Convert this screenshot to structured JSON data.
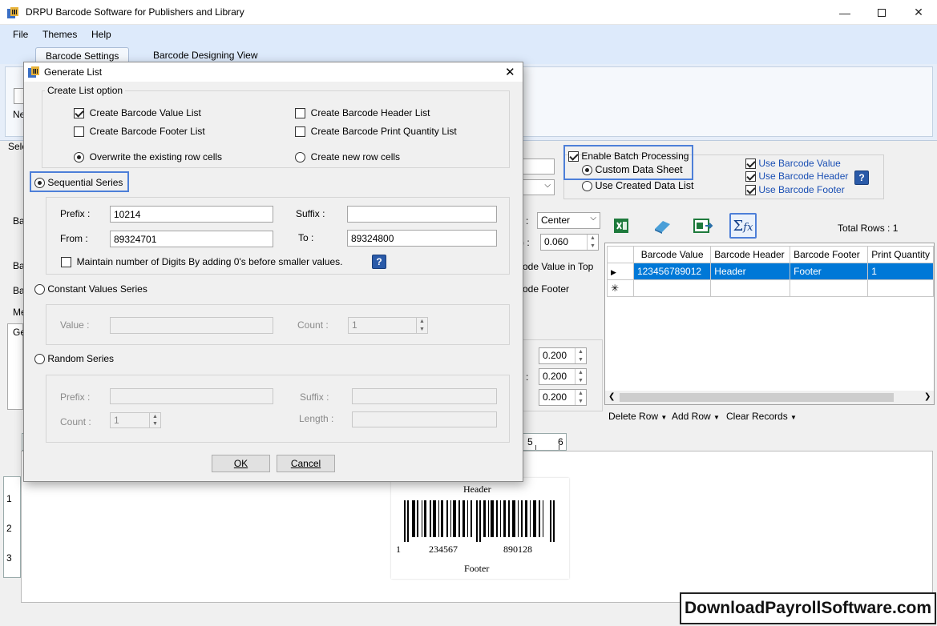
{
  "window": {
    "title": "DRPU Barcode Software for Publishers and Library"
  },
  "menu": [
    "File",
    "Themes",
    "Help"
  ],
  "tabs": [
    "Barcode Settings",
    "Barcode Designing View"
  ],
  "background": {
    "ribbon_partial": "Ne",
    "left_partial_sel": "Sele",
    "left_partials": [
      "Ba",
      "Ba",
      "Ba",
      "Me",
      "Ge"
    ],
    "alignment_value": "Center",
    "height_value": "0.060",
    "partial_text_value_top": "ode Value in Top",
    "partial_text_footer": "ode Footer",
    "margin_values": [
      "0.200",
      "0.200",
      "0.200"
    ]
  },
  "batch": {
    "enable_label": "Enable Batch Processing",
    "custom_label": "Custom Data Sheet",
    "created_label": "Use Created Data List",
    "use_value": "Use Barcode Value",
    "use_header": "Use Barcode Header",
    "use_footer": "Use Barcode Footer"
  },
  "grid": {
    "total_rows": "Total Rows : 1",
    "columns": [
      "Barcode Value",
      "Barcode Header",
      "Barcode Footer",
      "Print Quantity"
    ],
    "rows": [
      [
        "123456789012",
        "Header",
        "Footer",
        "1"
      ]
    ],
    "actions": [
      "Delete Row",
      "Add Row",
      "Clear Records"
    ]
  },
  "ruler": {
    "top_marks": [
      "5",
      "6"
    ],
    "left_marks": [
      "1",
      "2",
      "3"
    ]
  },
  "barcode_preview": {
    "header": "Header",
    "footer": "Footer",
    "digit_first": "1",
    "digits_left": "234567",
    "digits_right": "890128"
  },
  "watermark": "DownloadPayrollSoftware.com",
  "dialog": {
    "title": "Generate List",
    "create_list_title": "Create List option",
    "create_value_list": "Create Barcode Value List",
    "create_header_list": "Create Barcode Header List",
    "create_footer_list": "Create Barcode Footer List",
    "create_print_qty_list": "Create Barcode Print Quantity List",
    "overwrite_label": "Overwrite the existing row cells",
    "create_new_label": "Create new row cells",
    "sequential": {
      "label": "Sequential Series",
      "prefix_label": "Prefix :",
      "prefix_value": "10214",
      "suffix_label": "Suffix :",
      "suffix_value": "",
      "from_label": "From :",
      "from_value": "89324701",
      "to_label": "To :",
      "to_value": "89324800",
      "maintain_label": "Maintain number of Digits By adding 0's before smaller values."
    },
    "constant": {
      "label": "Constant Values Series",
      "value_label": "Value :",
      "value_value": "",
      "count_label": "Count :",
      "count_value": "1"
    },
    "random": {
      "label": "Random Series",
      "prefix_label": "Prefix :",
      "suffix_label": "Suffix :",
      "count_label": "Count :",
      "count_value": "1",
      "length_label": "Length :"
    },
    "ok_label": "OK",
    "cancel_label": "Cancel"
  }
}
